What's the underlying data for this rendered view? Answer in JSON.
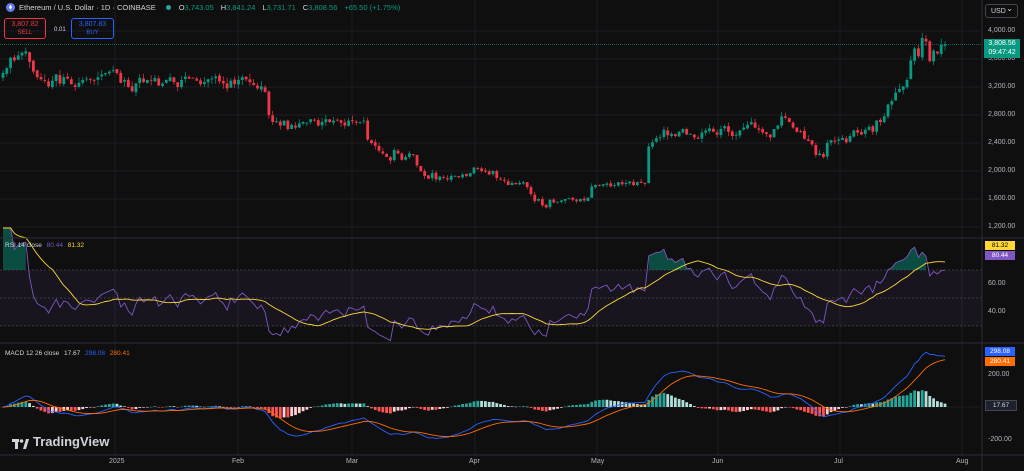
{
  "header": {
    "symbol_title": "Ethereum / U.S. Dollar · 1D · COINBASE",
    "open_label": "O",
    "open": "3,743.05",
    "high_label": "H",
    "high": "3,841.24",
    "low_label": "L",
    "low": "3,731.71",
    "close_label": "C",
    "close": "3,808.56",
    "change": "+65.50 (+1.75%)"
  },
  "trade": {
    "sell_price": "3,807.82",
    "sell_label": "SELL",
    "spread": "0.01",
    "buy_price": "3,807.83",
    "buy_label": "BUY"
  },
  "currency": "USD",
  "price_axis": [
    "4,000.00",
    "3,600.00",
    "3,200.00",
    "2,800.00",
    "2,400.00",
    "2,000.00",
    "1,600.00",
    "1,200.00"
  ],
  "last_price": {
    "price": "3,808.56",
    "countdown": "09:47:42"
  },
  "rsi": {
    "title": "RSI 14 close",
    "rsi_value": "80.44",
    "ma_value": "81.32",
    "axis": [
      "60.00",
      "40.00"
    ]
  },
  "macd": {
    "title": "MACD 12 26 close",
    "hist_value": "17.67",
    "macd_value": "298.08",
    "signal_value": "280.41",
    "axis": [
      "200.00",
      "-200.00"
    ]
  },
  "time_axis": [
    "2025",
    "Feb",
    "Mar",
    "Apr",
    "May",
    "Jun",
    "Jul",
    "Aug"
  ],
  "brand": "TradingView",
  "colors": {
    "up": "#089981",
    "down": "#f23645",
    "rsi": "#7e57c2",
    "rsi_ma": "#fdd835",
    "macd": "#2962ff",
    "signal": "#ff6d00"
  },
  "chart_data": {
    "type": "candlestick",
    "timeframe": "1D",
    "ylim": [
      1200,
      4000
    ],
    "closes": [
      3400,
      3470,
      3620,
      3580,
      3650,
      3690,
      3710,
      3560,
      3420,
      3340,
      3310,
      3290,
      3210,
      3290,
      3380,
      3250,
      3340,
      3320,
      3240,
      3200,
      3260,
      3300,
      3320,
      3310,
      3290,
      3340,
      3380,
      3400,
      3420,
      3440,
      3400,
      3260,
      3300,
      3200,
      3140,
      3250,
      3330,
      3270,
      3300,
      3290,
      3330,
      3220,
      3250,
      3300,
      3340,
      3270,
      3200,
      3300,
      3350,
      3320,
      3330,
      3290,
      3240,
      3270,
      3310,
      3320,
      3350,
      3280,
      3250,
      3180,
      3290,
      3240,
      3300,
      3340,
      3310,
      3270,
      3230,
      3180,
      3210,
      3130,
      2800,
      2700,
      2710,
      2650,
      2720,
      2600,
      2660,
      2620,
      2680,
      2700,
      2690,
      2740,
      2720,
      2650,
      2700,
      2740,
      2700,
      2720,
      2730,
      2690,
      2650,
      2720,
      2710,
      2690,
      2700,
      2720,
      2450,
      2400,
      2360,
      2290,
      2250,
      2200,
      2150,
      2300,
      2250,
      2160,
      2200,
      2250,
      2230,
      2080,
      2000,
      1930,
      1890,
      1970,
      1880,
      1920,
      1900,
      1880,
      1930,
      1930,
      1910,
      1950,
      1930,
      1970,
      2050,
      2030,
      2000,
      1990,
      1950,
      2000,
      1900,
      1880,
      1860,
      1800,
      1830,
      1810,
      1830,
      1840,
      1770,
      1670,
      1570,
      1600,
      1510,
      1480,
      1590,
      1550,
      1560,
      1580,
      1600,
      1610,
      1590,
      1570,
      1600,
      1580,
      1620,
      1780,
      1800,
      1790,
      1810,
      1820,
      1780,
      1800,
      1840,
      1810,
      1830,
      1850,
      1800,
      1840,
      1830,
      1820,
      2350,
      2410,
      2470,
      2480,
      2590,
      2510,
      2530,
      2500,
      2560,
      2600,
      2520,
      2530,
      2480,
      2460,
      2550,
      2580,
      2610,
      2560,
      2520,
      2600,
      2640,
      2560,
      2500,
      2520,
      2580,
      2620,
      2660,
      2700,
      2620,
      2590,
      2550,
      2530,
      2480,
      2600,
      2650,
      2780,
      2760,
      2700,
      2620,
      2560,
      2570,
      2460,
      2430,
      2380,
      2230,
      2250,
      2200,
      2400,
      2440,
      2420,
      2450,
      2470,
      2410,
      2500,
      2580,
      2550,
      2520,
      2590,
      2630,
      2560,
      2720,
      2700,
      2780,
      2950,
      3000,
      3120,
      3170,
      3210,
      3300,
      3580,
      3750,
      3640,
      3900,
      3850,
      3570,
      3720,
      3680,
      3800,
      3808.56
    ],
    "rsi": {
      "ylim": [
        20,
        90
      ],
      "levels": [
        70,
        50,
        30
      ]
    },
    "macd": {
      "ylim": [
        -260,
        330
      ],
      "levels": [
        0
      ]
    }
  }
}
